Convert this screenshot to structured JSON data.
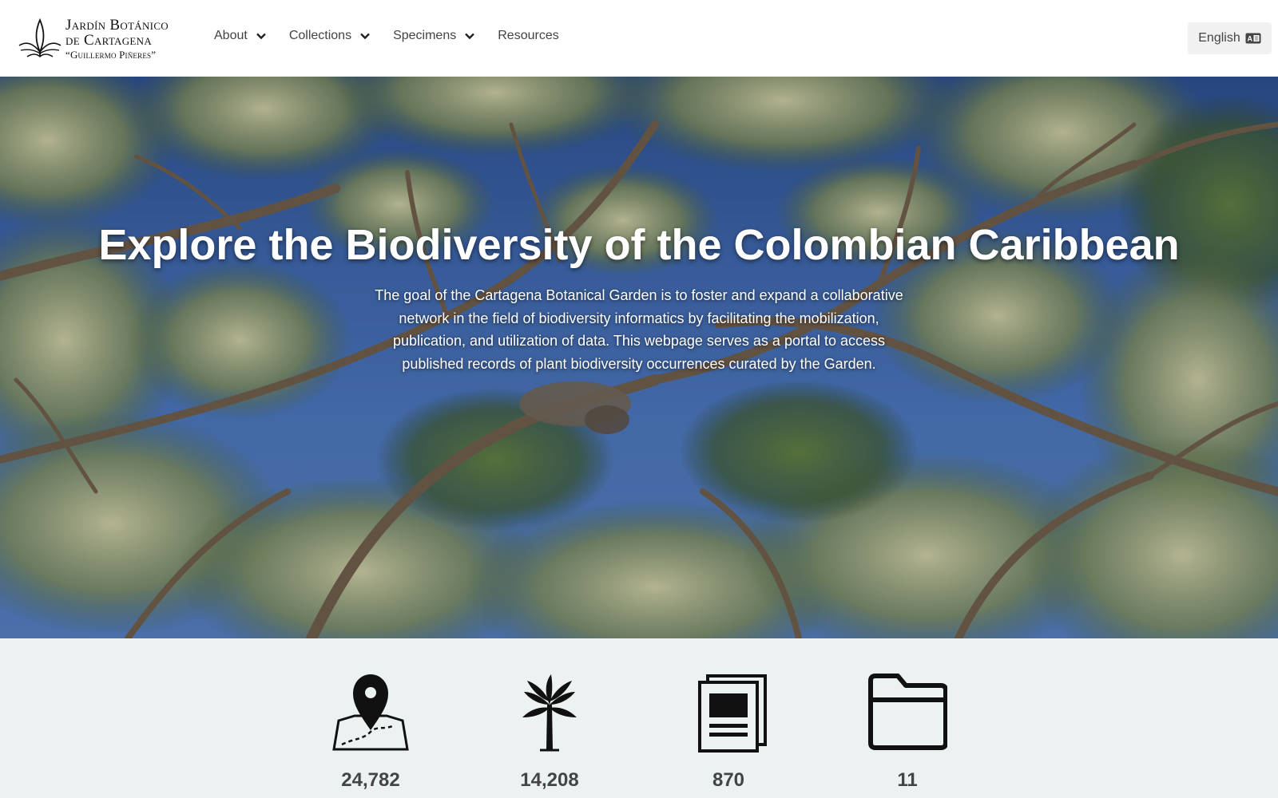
{
  "logo": {
    "line1": "Jardín Botánico",
    "line2": "de Cartagena",
    "line3": "“Guillermo Piñeres”"
  },
  "nav": {
    "items": [
      {
        "label": "About",
        "icon": "chevron-down-icon"
      },
      {
        "label": "Collections",
        "icon": "chevron-down-icon"
      },
      {
        "label": "Specimens",
        "icon": "chevron-down-icon"
      },
      {
        "label": "Resources"
      }
    ]
  },
  "language": {
    "label": "English",
    "icon": "language-card-icon"
  },
  "hero": {
    "title": "Explore the Biodiversity of the Colombian Caribbean",
    "description": "The goal of the Cartagena Botanical Garden is to foster and expand a collaborative network in the field of biodiversity informatics by facilitating the mobilization, publication, and utilization of data. This webpage serves as a portal to access published records of plant biodiversity occurrences curated by the Garden."
  },
  "stats": [
    {
      "icon": "map-pin-icon",
      "value": "24,782"
    },
    {
      "icon": "palm-tree-icon",
      "value": "14,208"
    },
    {
      "icon": "documents-icon",
      "value": "870"
    },
    {
      "icon": "folder-icon",
      "value": "11"
    }
  ],
  "colors": {
    "header_bg": "#ffffff",
    "sky": "#3d64a7",
    "stats_bg": "#ecf1f1",
    "text": "#444444"
  }
}
